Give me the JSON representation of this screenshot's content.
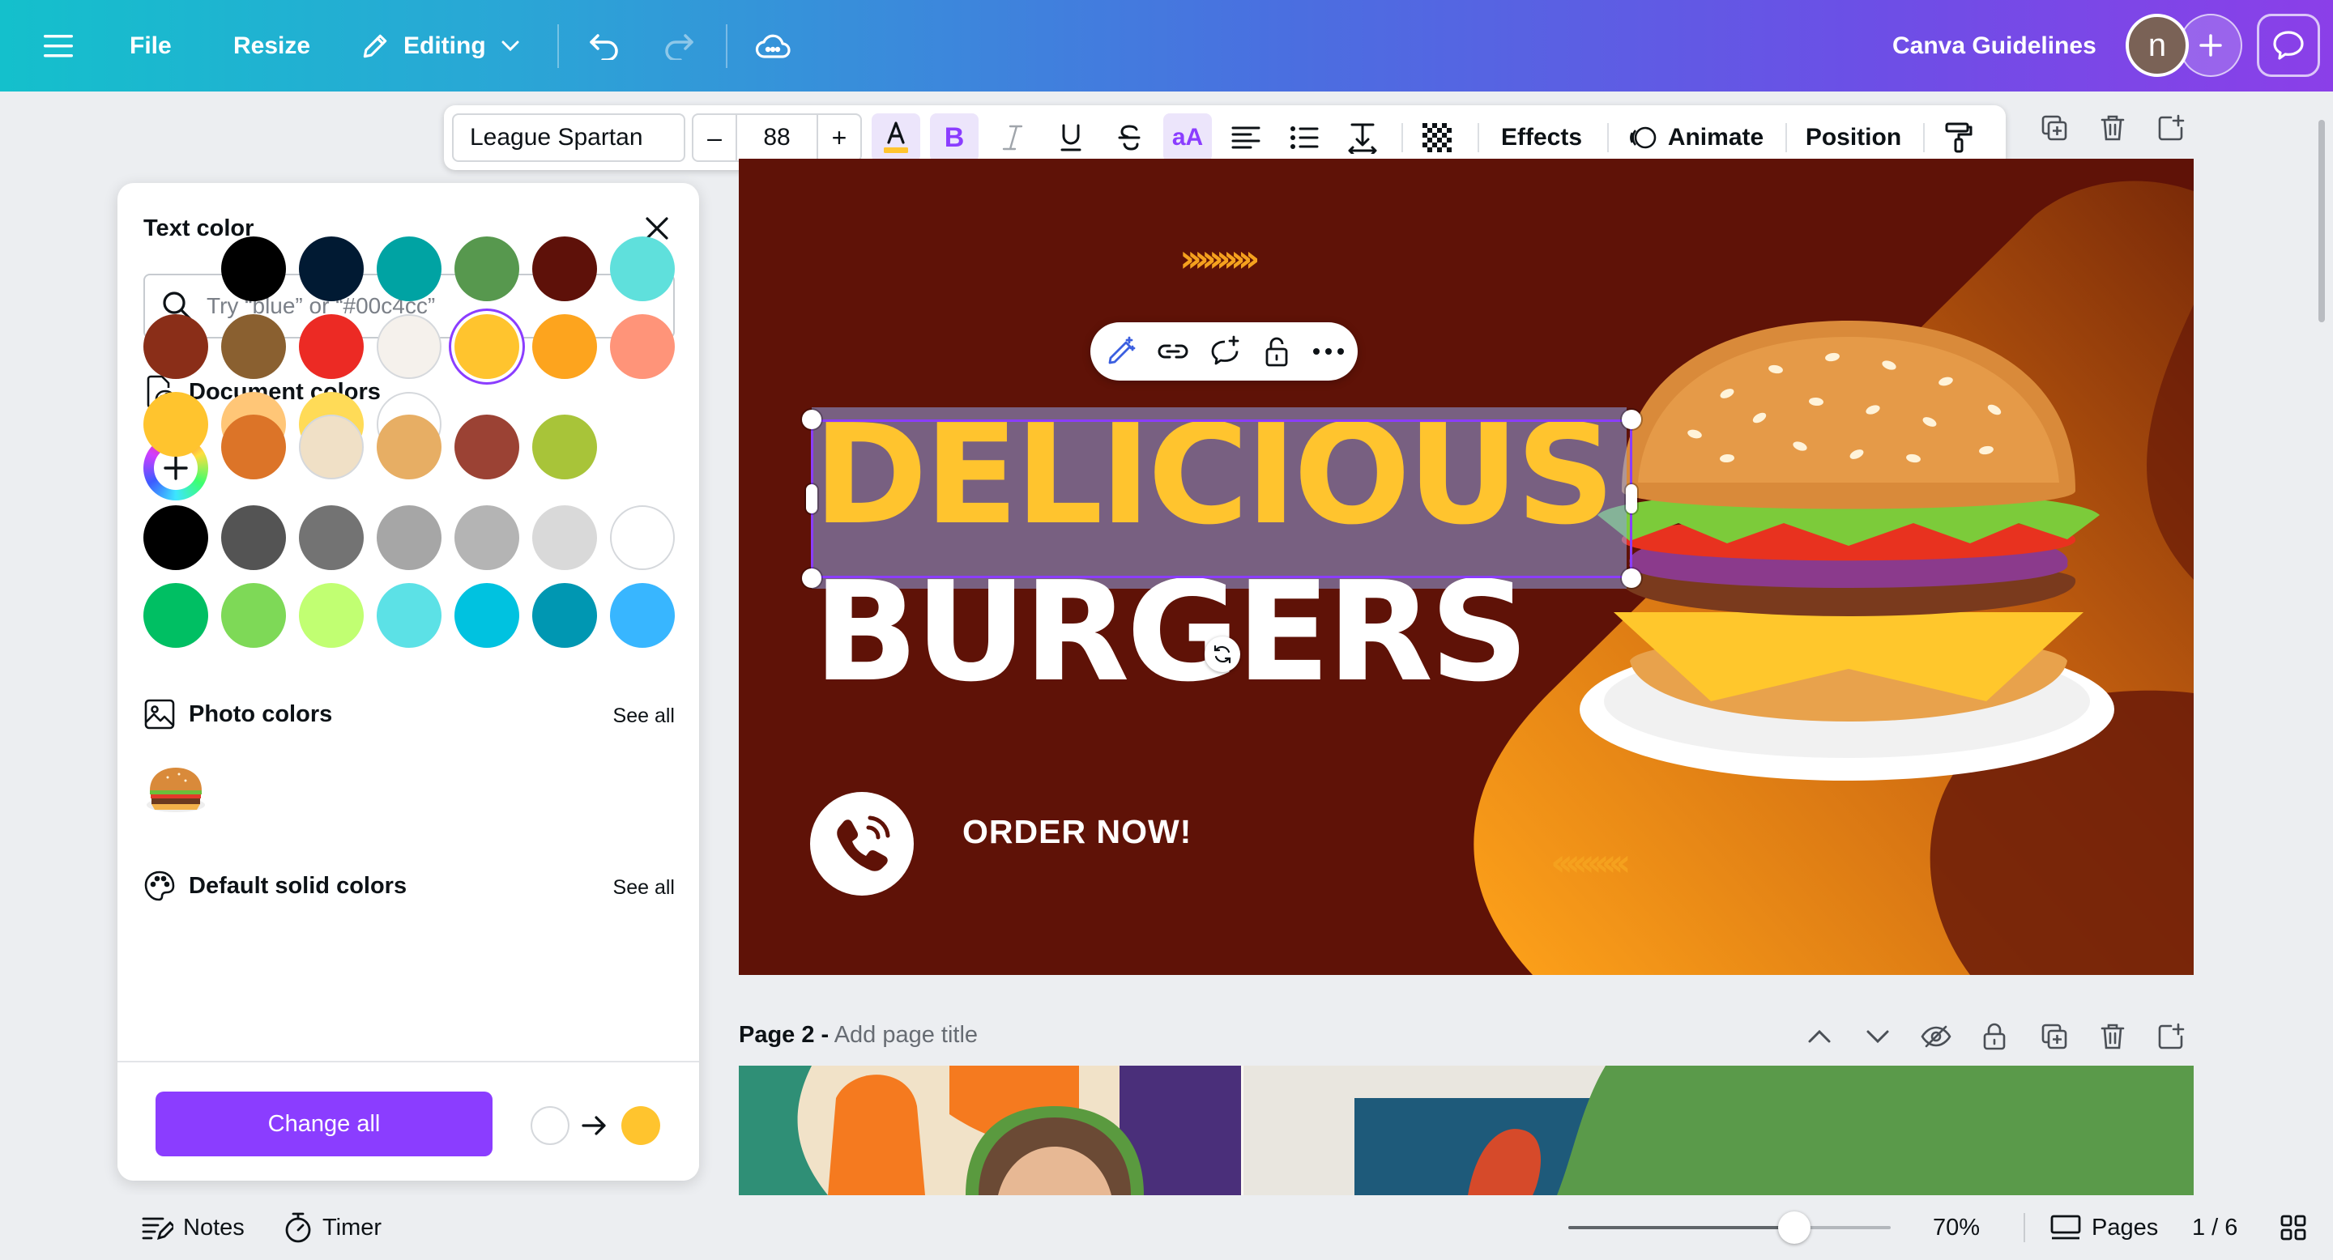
{
  "topbar": {
    "file": "File",
    "resize": "Resize",
    "editing": "Editing",
    "design_title": "Canva Guidelines",
    "avatar_initial": "n"
  },
  "format_toolbar": {
    "font_family": "League Spartan",
    "font_size": "88",
    "minus": "–",
    "plus": "+",
    "bold": "B",
    "case": "aA",
    "effects": "Effects",
    "animate": "Animate",
    "position": "Position"
  },
  "text_color_panel": {
    "title": "Text color",
    "search_placeholder": "Try “blue” or “#00c4cc”",
    "document_colors": {
      "heading": "Document colors",
      "swatches": [
        "#000000",
        "#011a33",
        "#00a3a3",
        "#57984e",
        "#5e1109",
        "#5fe0dc",
        "#8a2e18",
        "#8a6030",
        "#ec2a24",
        "#f5f1ec",
        "#ffc42e",
        "#fda41e",
        "#ff9479",
        "#ffc42e",
        "#ffc677",
        "#ffdb57",
        "#ffffff"
      ],
      "selected": "#ffc42e"
    },
    "photo_colors": {
      "heading": "Photo colors",
      "see_all": "See all",
      "swatches": [
        "#dc7428",
        "#f0e0c6",
        "#e7ae64",
        "#9b4234",
        "#a8c439"
      ]
    },
    "default_solid_colors": {
      "heading": "Default solid colors",
      "see_all": "See all",
      "swatches": [
        "#000000",
        "#545454",
        "#737373",
        "#a6a6a6",
        "#b4b4b4",
        "#d9d9d9",
        "#ffffff",
        "#00bf63",
        "#7ed957",
        "#c1ff72",
        "#5ce1e6",
        "#00c2e0",
        "#0097b2",
        "#38b6ff"
      ]
    },
    "change_all": "Change all",
    "change_from": "#ffffff",
    "change_to": "#ffc42e"
  },
  "canvas": {
    "headline_1": "DELICIOUS",
    "headline_2": "BURGERS",
    "order_text": "ORDER NOW!",
    "chevrons_right": "››››››››››",
    "chevrons_left": "‹‹‹‹‹‹‹‹‹‹"
  },
  "page2": {
    "label": "Page 2 -",
    "title_placeholder": "Add page title"
  },
  "bottombar": {
    "notes": "Notes",
    "timer": "Timer",
    "zoom": "70%",
    "zoom_level": 0.7,
    "pages": "Pages",
    "page_count": "1 / 6"
  },
  "colors": {
    "accent": "#8b3dff",
    "canvas_bg": "#5f1207",
    "headline_yellow": "#ffc42e"
  }
}
